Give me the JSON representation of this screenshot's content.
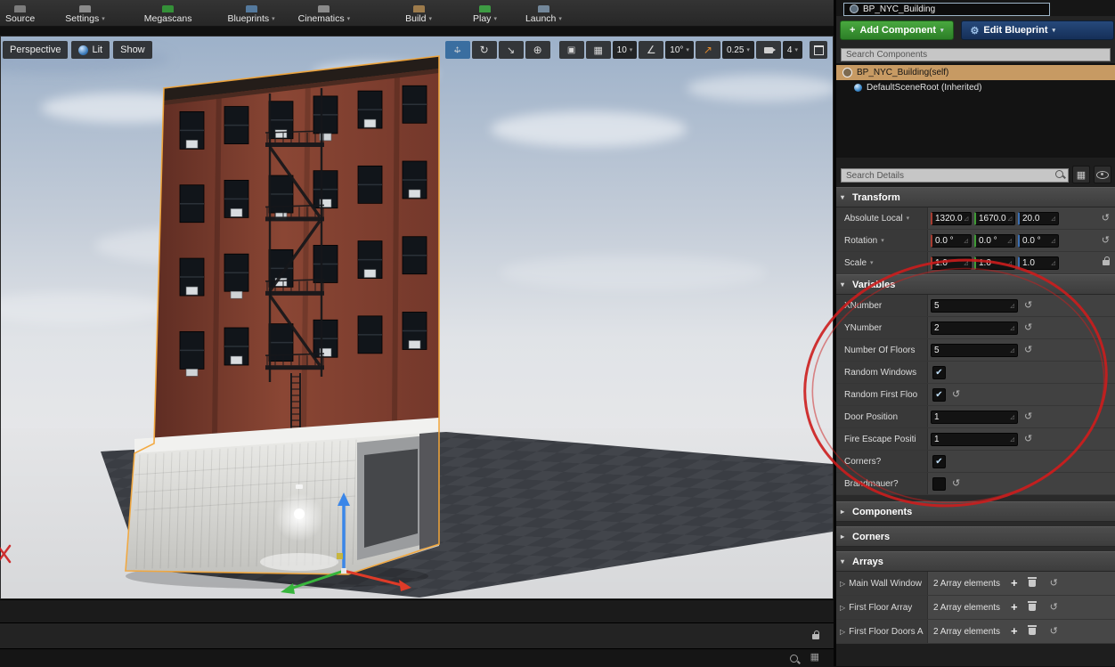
{
  "toolbar": {
    "items": [
      {
        "label": "Source",
        "icon": "source-control-icon",
        "color": "#8a8a8a",
        "gap": 0,
        "caret": false
      },
      {
        "label": "Settings",
        "icon": "settings-icon",
        "color": "#9a9a9a",
        "gap": 34,
        "caret": true
      },
      {
        "label": "Megascans",
        "icon": "megascans-icon",
        "color": "#35a13a",
        "gap": 44,
        "caret": false
      },
      {
        "label": "Blueprints",
        "icon": "blueprints-icon",
        "color": "#5a86b0",
        "gap": 40,
        "caret": true
      },
      {
        "label": "Cinematics",
        "icon": "cinematics-icon",
        "color": "#9a9a9a",
        "gap": 26,
        "caret": true
      },
      {
        "label": "Build",
        "icon": "build-icon",
        "color": "#b08850",
        "gap": 62,
        "caret": true
      },
      {
        "label": "Play",
        "icon": "play-icon",
        "color": "#3fae46",
        "gap": 46,
        "caret": true
      },
      {
        "label": "Launch",
        "icon": "launch-icon",
        "color": "#7f96ad",
        "gap": 32,
        "caret": true
      }
    ]
  },
  "viewport": {
    "perspective_label": "Perspective",
    "lit_label": "Lit",
    "show_label": "Show",
    "snap": {
      "grid_value": "10",
      "angle_value": "10°",
      "scale_value": "0.25",
      "camera_speed": "4"
    }
  },
  "details": {
    "tab_title": "BP_NYC_Building",
    "add_component_label": "Add Component",
    "edit_blueprint_label": "Edit Blueprint",
    "search_components_placeholder": "Search Components",
    "search_details_placeholder": "Search Details",
    "tree": [
      {
        "label": "BP_NYC_Building(self)",
        "selected": true
      },
      {
        "label": "DefaultSceneRoot (Inherited)",
        "selected": false
      }
    ],
    "transform": {
      "header": "Transform",
      "rows": [
        {
          "label": "Absolute Local",
          "caret": true,
          "values": [
            "1320.0",
            "1670.0",
            "20.0"
          ],
          "revert": true,
          "lock": false
        },
        {
          "label": "Rotation",
          "caret": true,
          "values": [
            "0.0 °",
            "0.0 °",
            "0.0 °"
          ],
          "revert": true,
          "lock": false
        },
        {
          "label": "Scale",
          "caret": true,
          "values": [
            "1.0",
            "1.0",
            "1.0"
          ],
          "revert": false,
          "lock": true
        }
      ],
      "axis_colors": [
        "#a83c30",
        "#3f9b35",
        "#3b6fb3"
      ]
    },
    "variables": {
      "header": "Variables",
      "rows": [
        {
          "label": "XNumber",
          "type": "number",
          "value": "5",
          "revert": true
        },
        {
          "label": "YNumber",
          "type": "number",
          "value": "2",
          "revert": true
        },
        {
          "label": "Number Of Floors",
          "type": "number",
          "value": "5",
          "revert": true
        },
        {
          "label": "Random Windows",
          "type": "checkbox",
          "checked": true,
          "revert": false
        },
        {
          "label": "Random First Floo",
          "type": "checkbox",
          "checked": true,
          "revert": true
        },
        {
          "label": "Door Position",
          "type": "number",
          "value": "1",
          "revert": true
        },
        {
          "label": "Fire Escape Positi",
          "type": "number",
          "value": "1",
          "revert": true
        },
        {
          "label": "Corners?",
          "type": "checkbox",
          "checked": true,
          "revert": false
        },
        {
          "label": "Brandmauer?",
          "type": "checkbox",
          "checked": false,
          "revert": true
        }
      ]
    },
    "collapsed_sections": [
      {
        "header": "Components"
      },
      {
        "header": "Corners"
      }
    ],
    "arrays": {
      "header": "Arrays",
      "rows": [
        {
          "label": "Main Wall Window",
          "value": "2 Array elements"
        },
        {
          "label": "First Floor Array",
          "value": "2 Array elements"
        },
        {
          "label": "First Floor Doors A",
          "value": "2 Array elements"
        }
      ]
    }
  },
  "annotation": {
    "color": "#cc1d1d"
  }
}
